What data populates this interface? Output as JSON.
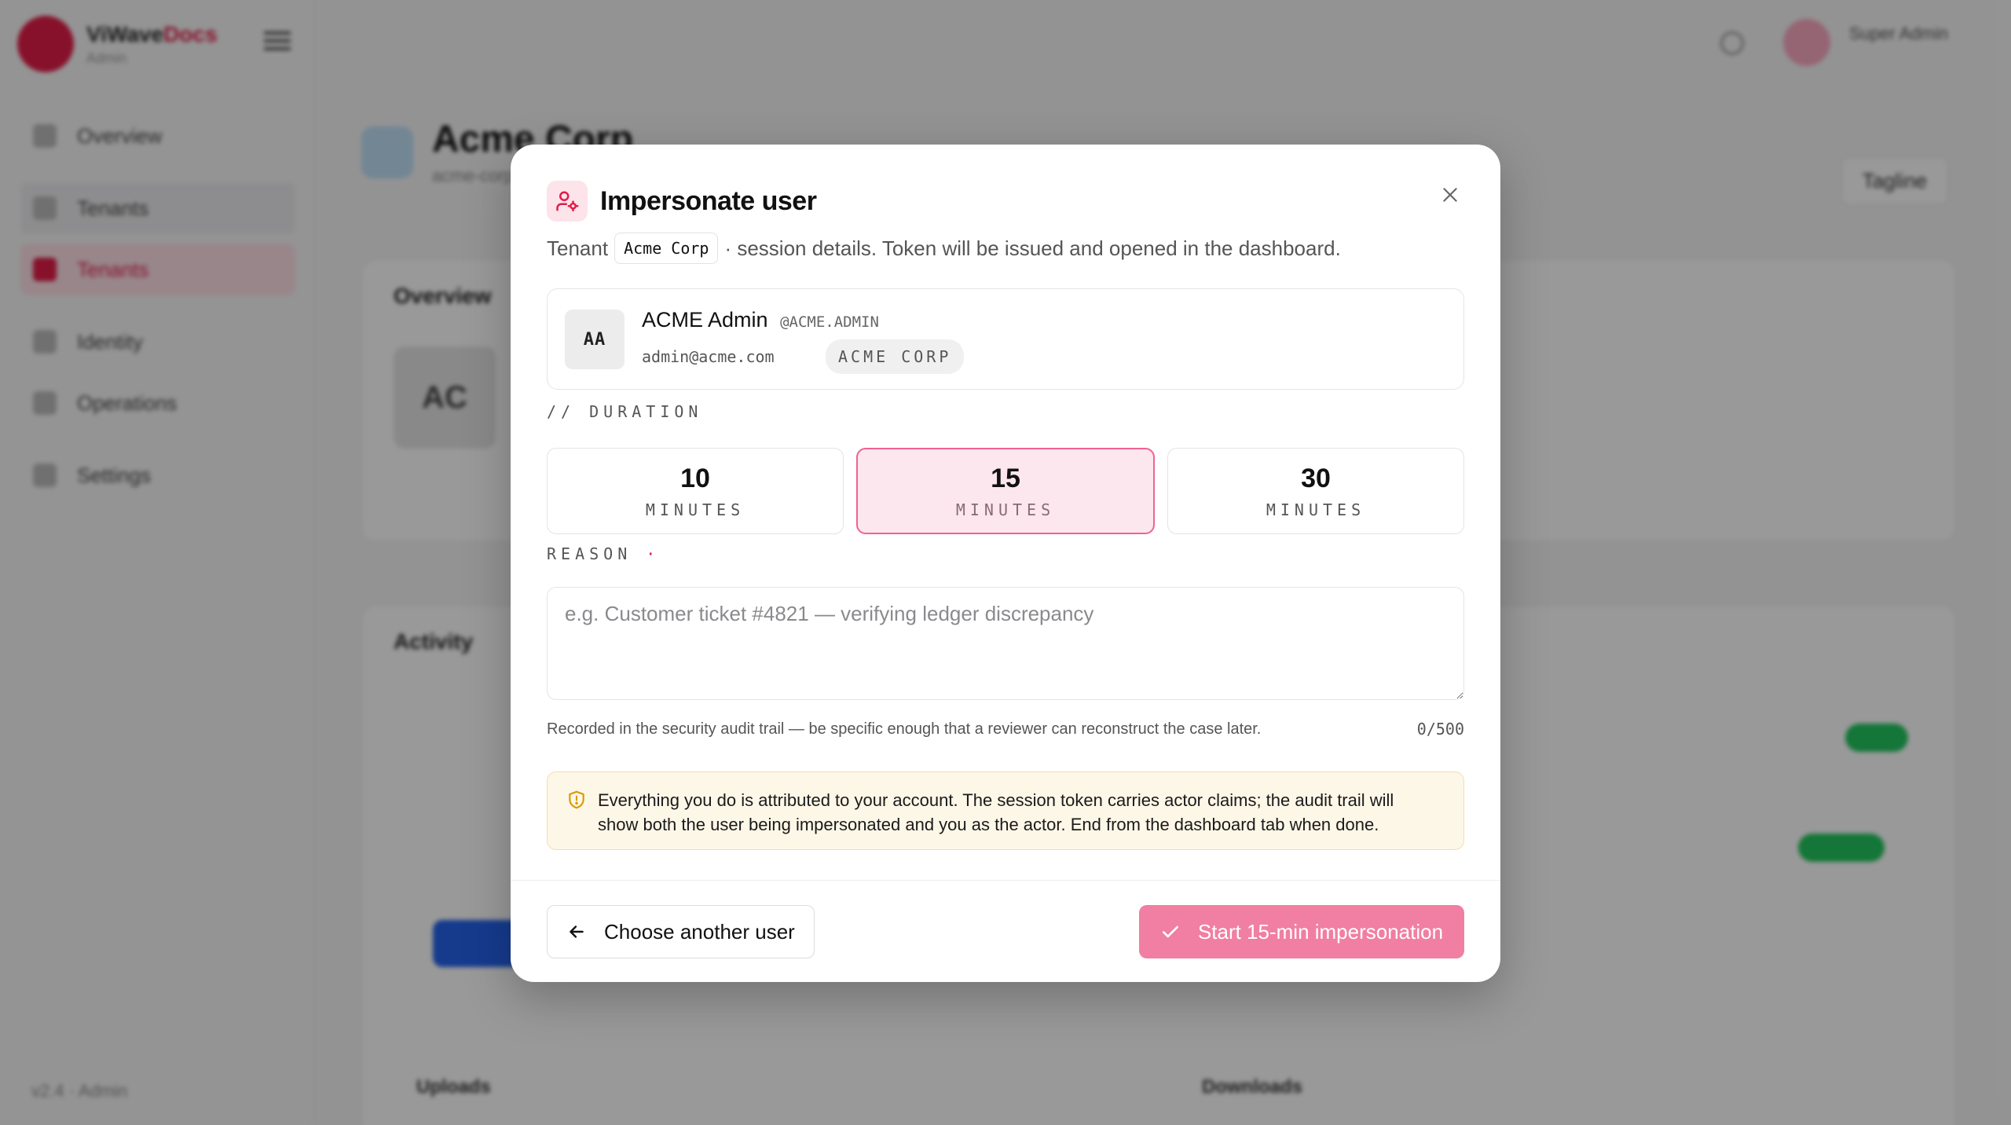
{
  "background": {
    "brand": {
      "name_part1": "ViWave",
      "name_part2": "Docs",
      "sub": "Admin"
    },
    "nav": [
      {
        "label": "Overview"
      },
      {
        "label": "Tenants"
      },
      {
        "label": "Tenants"
      },
      {
        "label": "Identity"
      },
      {
        "label": "Operations"
      },
      {
        "label": "Settings"
      }
    ],
    "footer": "v2.4 · Admin",
    "topbar": {
      "user": "Super Admin"
    },
    "page": {
      "title": "Acme Corp",
      "subtitle": "acme-corp",
      "action": "Tagline"
    },
    "cards": {
      "overview": "Overview",
      "initials": "AC",
      "activity": "Activity",
      "uploads": "Uploads",
      "downloads": "Downloads"
    }
  },
  "modal": {
    "title": "Impersonate user",
    "desc_prefix": "Tenant",
    "tenant_chip": "Acme Corp",
    "desc_suffix": "· session details. Token will be issued and opened in the dashboard.",
    "user": {
      "initials": "AA",
      "name": "ACME Admin",
      "handle": "@ACME.ADMIN",
      "email": "admin@acme.com",
      "tenant": "ACME CORP"
    },
    "duration_label": "// DURATION",
    "durations": [
      {
        "value": "10",
        "unit": "MINUTES",
        "selected": false
      },
      {
        "value": "15",
        "unit": "MINUTES",
        "selected": true
      },
      {
        "value": "30",
        "unit": "MINUTES",
        "selected": false
      }
    ],
    "reason_label": "REASON",
    "reason_required_mark": "·",
    "reason_placeholder": "e.g. Customer ticket #4821 — verifying ledger discrepancy",
    "reason_value": "",
    "helper": "Recorded in the security audit trail — be specific enough that a reviewer can reconstruct the case later.",
    "counter": "0/500",
    "warning": "Everything you do is attributed to your account. The session token carries actor claims; the audit trail will show both the user being impersonated and you as the actor. End from the dashboard tab when done.",
    "back_button": "Choose another user",
    "start_button": "Start 15-min impersonation",
    "colors": {
      "accent": "#e11d48",
      "start_button": "#f07fa3",
      "selected_bg": "#fce7ee",
      "warning_bg": "#fdf7e8"
    }
  }
}
